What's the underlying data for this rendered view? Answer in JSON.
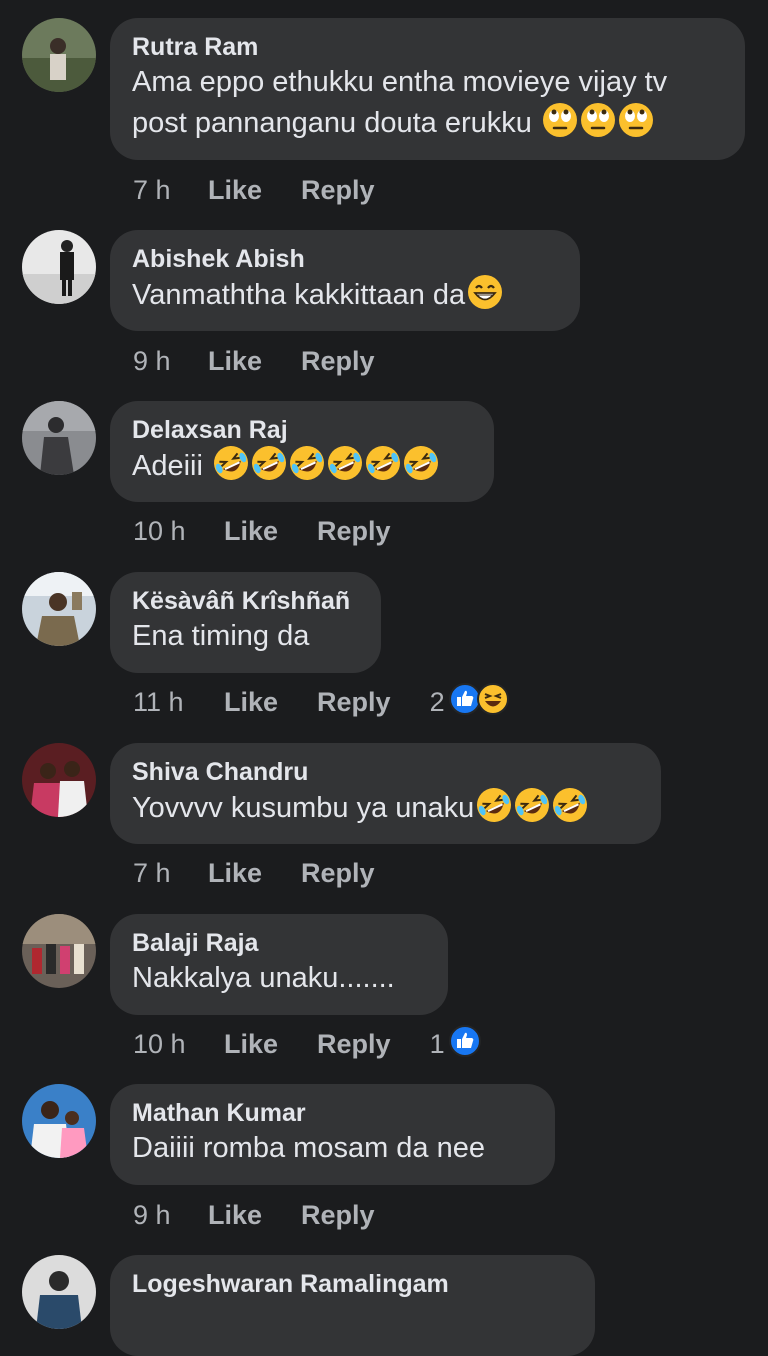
{
  "comments": [
    {
      "name": "Rutra Ram",
      "text_lines": [
        "Ama eppo ethukku entha movieye vijay tv",
        "post pannanganu douta erukku"
      ],
      "emoji": [
        "rolling-eyes",
        "rolling-eyes",
        "rolling-eyes"
      ],
      "time": "7 h",
      "like": "Like",
      "reply": "Reply",
      "reaction_count": "",
      "reactions": []
    },
    {
      "name": "Abishek Abish",
      "text_lines": [
        "Vanmaththa kakkittaan da"
      ],
      "emoji": [
        "grinning"
      ],
      "time": "9 h",
      "like": "Like",
      "reply": "Reply",
      "reaction_count": "",
      "reactions": []
    },
    {
      "name": "Delaxsan Raj",
      "text_lines": [
        "Adeiii "
      ],
      "emoji": [
        "rofl",
        "rofl",
        "rofl",
        "rofl",
        "rofl",
        "rofl"
      ],
      "time": "10 h",
      "like": "Like",
      "reply": "Reply",
      "reaction_count": "",
      "reactions": []
    },
    {
      "name": "Kësàvâñ Krîshñañ",
      "text_lines": [
        "Ena timing da"
      ],
      "emoji": [],
      "time": "11 h",
      "like": "Like",
      "reply": "Reply",
      "reaction_count": "2",
      "reactions": [
        "like",
        "haha"
      ]
    },
    {
      "name": "Shiva Chandru",
      "text_lines": [
        "Yovvvv kusumbu ya unaku"
      ],
      "emoji": [
        "rofl",
        "rofl",
        "rofl"
      ],
      "time": "7 h",
      "like": "Like",
      "reply": "Reply",
      "reaction_count": "",
      "reactions": []
    },
    {
      "name": "Balaji Raja",
      "text_lines": [
        "Nakkalya unaku......."
      ],
      "emoji": [],
      "time": "10 h",
      "like": "Like",
      "reply": "Reply",
      "reaction_count": "1",
      "reactions": [
        "like"
      ]
    },
    {
      "name": "Mathan Kumar",
      "text_lines": [
        "Daiiii romba mosam da nee"
      ],
      "emoji": [],
      "time": "9 h",
      "like": "Like",
      "reply": "Reply",
      "reaction_count": "",
      "reactions": []
    }
  ],
  "partial_comment": {
    "name": "Logeshwaran Ramalingam"
  },
  "colors": {
    "background": "#1b1c1e",
    "bubble": "#333436",
    "name": "#e4e6eb",
    "meta": "#b0b3b8",
    "like_reaction": "#1877f2",
    "emoji_yellow": "#fbc02d"
  }
}
